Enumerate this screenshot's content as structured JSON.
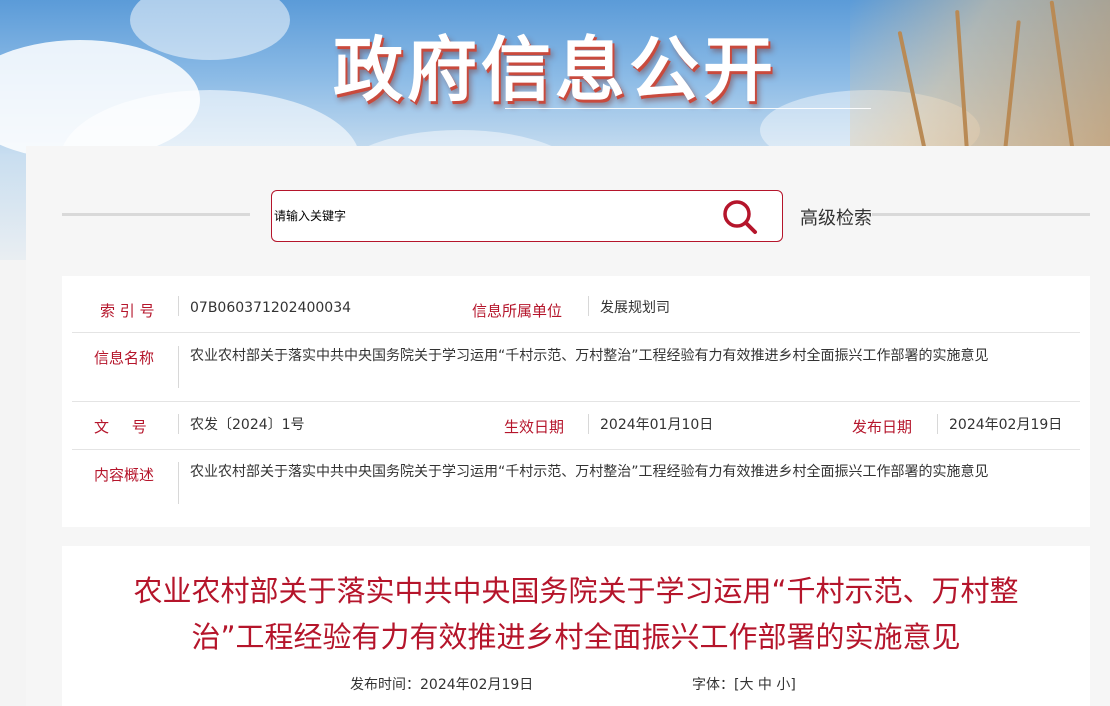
{
  "banner": {
    "title": "政府信息公开"
  },
  "search": {
    "placeholder": "请输入关键字",
    "advanced_label": "高级检索",
    "icon": "search-icon"
  },
  "info": {
    "index_label": "索 引 号",
    "index_value": "07B060371202400034",
    "unit_label": "信息所属单位",
    "unit_value": "发展规划司",
    "name_label": "信息名称",
    "name_value": "农业农村部关于落实中共中央国务院关于学习运用“千村示范、万村整治”工程经验有力有效推进乡村全面振兴工作部署的实施意见",
    "doc_label": "文 号",
    "doc_value": "农发〔2024〕1号",
    "effective_label": "生效日期",
    "effective_value": "2024年01月10日",
    "publish_label": "发布日期",
    "publish_value": "2024年02月19日",
    "summary_label": "内容概述",
    "summary_value": "农业农村部关于落实中共中央国务院关于学习运用“千村示范、万村整治”工程经验有力有效推进乡村全面振兴工作部署的实施意见"
  },
  "article": {
    "title": "农业农村部关于落实中共中央国务院关于学习运用“千村示范、万村整治”工程经验有力有效推进乡村全面振兴工作部署的实施意见",
    "publish_time_label": "发布时间：",
    "publish_time": "2024年02月19日",
    "font_label": "字体：",
    "font_open": "[",
    "font_large": "大",
    "font_medium": "中",
    "font_small": "小",
    "font_close": "]"
  },
  "colors": {
    "accent": "#b5152b",
    "text": "#333333"
  }
}
